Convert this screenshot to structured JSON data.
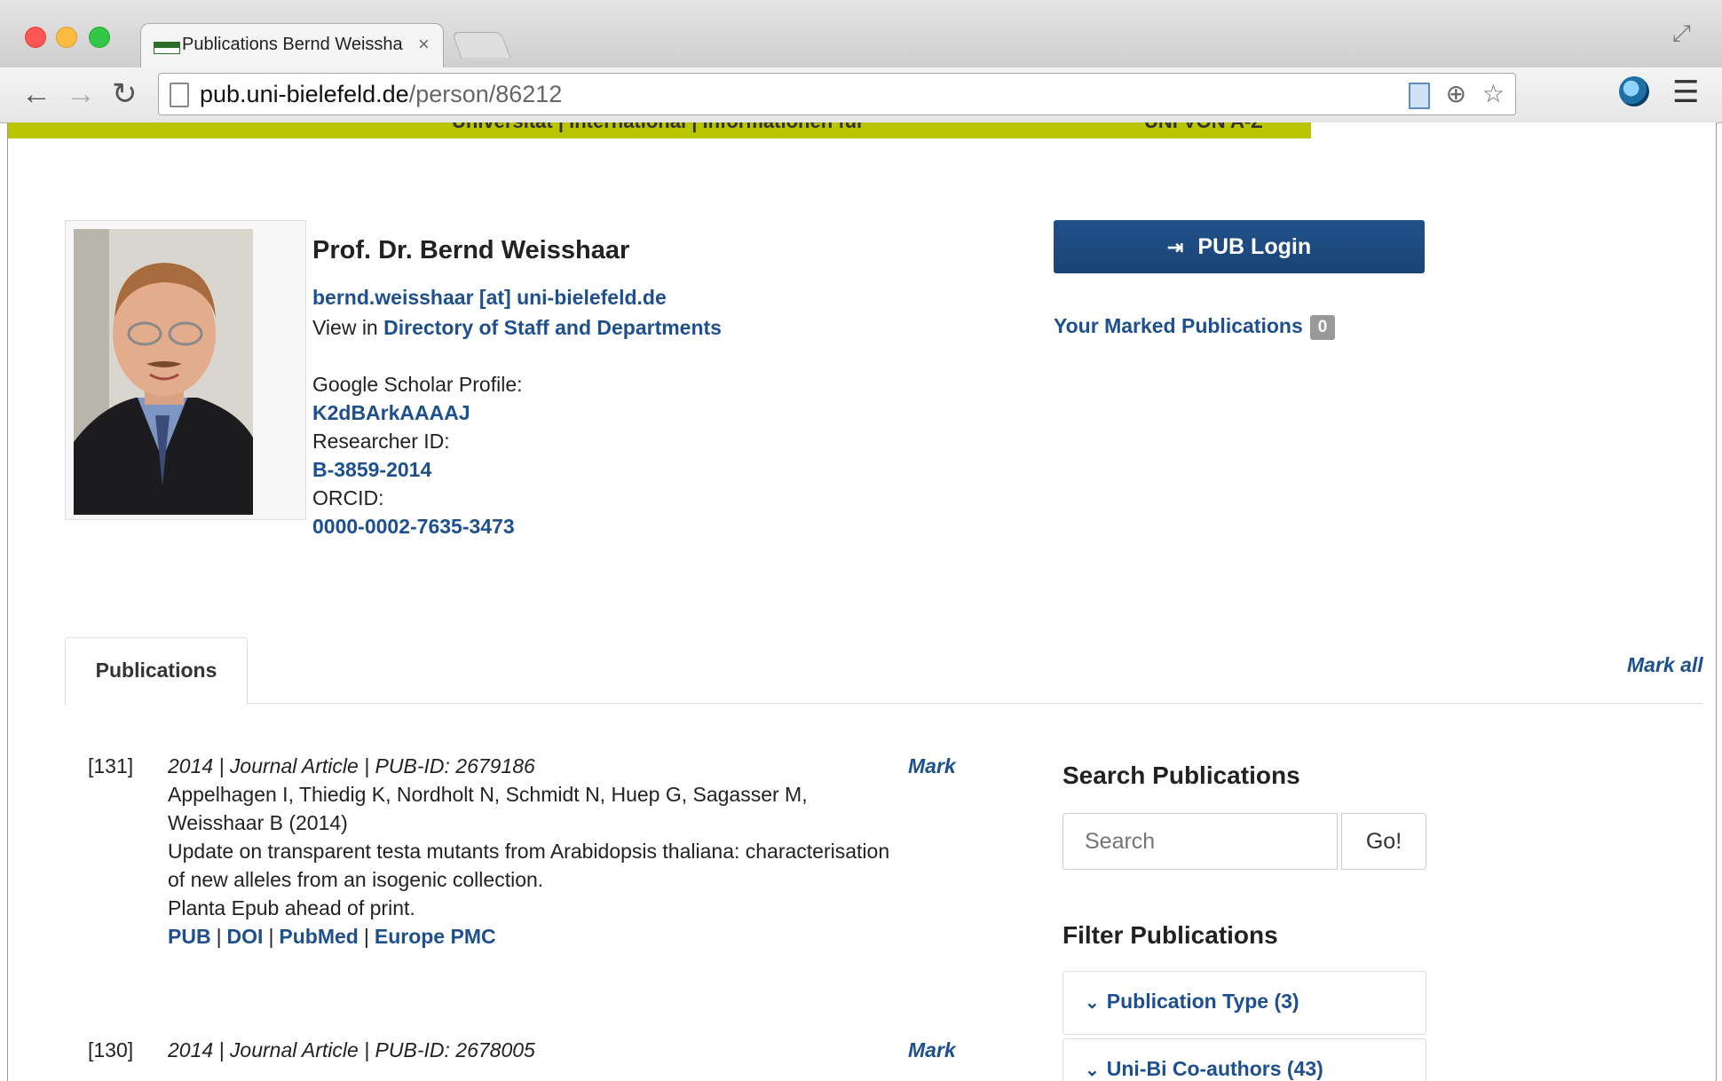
{
  "browser": {
    "tab_title": "Publications Bernd Weissha",
    "tab_close": "×",
    "url_host": "pub.uni-bielefeld.de",
    "url_path": "/person/86212"
  },
  "header_strip": {
    "text": "Universität | International | Informationen für",
    "right": "UNI VON A-Z"
  },
  "profile": {
    "name": "Prof. Dr. Bernd Weisshaar",
    "email": "bernd.weisshaar [at] uni-bielefeld.de",
    "view_in_prefix": "View in",
    "directory_link": "Directory of Staff and Departments",
    "google_label": "Google Scholar Profile:",
    "google_id": "K2dBArkAAAAJ",
    "researcher_label": "Researcher ID:",
    "researcher_id": "B-3859-2014",
    "orcid_label": "ORCID:",
    "orcid_id": "0000-0002-7635-3473"
  },
  "sidebar": {
    "login_label": "PUB Login",
    "marked_label": "Your Marked Publications",
    "marked_count": "0",
    "search_heading": "Search Publications",
    "search_placeholder": "Search",
    "go_label": "Go!",
    "filter_heading": "Filter Publications",
    "filters": [
      {
        "label": "Publication Type (3)"
      },
      {
        "label": "Uni-Bi Co-authors (43)"
      }
    ]
  },
  "tabs": {
    "publications": "Publications",
    "mark_all": "Mark all"
  },
  "entries": [
    {
      "num": "[131]",
      "meta": "2014 | Journal Article | PUB-ID: 2679186",
      "mark": "Mark",
      "authors1": "Appelhagen I, Thiedig K, Nordholt N, Schmidt N, Huep G, Sagasser M,",
      "authors2": "Weisshaar B (2014)",
      "title1": "Update on transparent testa mutants from Arabidopsis thaliana: characterisation",
      "title2": "of new alleles from an isogenic collection.",
      "journal": "Planta Epub ahead of print.",
      "links": [
        "PUB",
        "DOI",
        "PubMed",
        "Europe PMC"
      ]
    },
    {
      "num": "[130]",
      "meta": "2014 | Journal Article | PUB-ID: 2678005",
      "mark": "Mark"
    }
  ]
}
